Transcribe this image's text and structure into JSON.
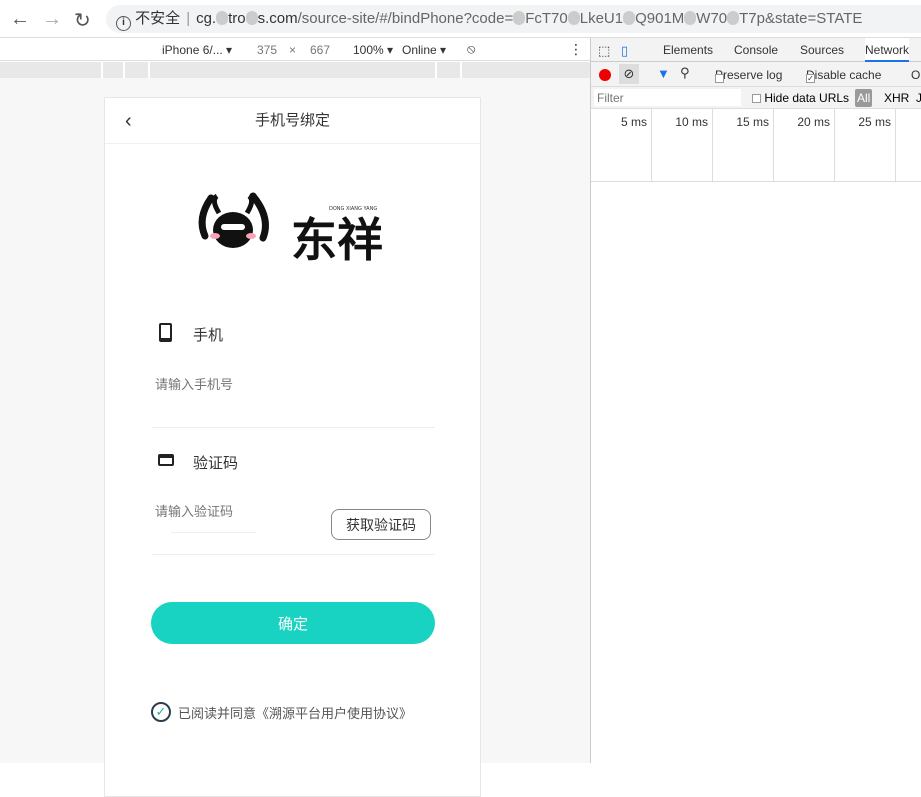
{
  "browser": {
    "insecure_label": "不安全",
    "url_host_a": "cg.",
    "url_host_b": "tro",
    "url_host_c": "s.com",
    "url_path": "/source-site/#/bindPhone?code=",
    "url_q1": "FcT70",
    "url_q2": "LkeU1",
    "url_q3": "Q901M",
    "url_q4": "W70",
    "url_q5": "T7p&state=STATE"
  },
  "device_toolbar": {
    "device": "iPhone 6/...",
    "width": "375",
    "x": "×",
    "height": "667",
    "zoom": "100%",
    "network": "Online"
  },
  "page": {
    "title": "手机号绑定",
    "logo_text": "东祥",
    "logo_sub": "DONG XIANG YANG",
    "phone_label": "手机",
    "phone_placeholder": "请输入手机号",
    "code_label": "验证码",
    "code_placeholder": "请输入验证码",
    "get_code": "获取验证码",
    "confirm": "确定",
    "agree_text": "已阅读并同意《溯源平台用户使用协议》",
    "accent": "#18d3c2"
  },
  "devtools": {
    "tabs": [
      "Elements",
      "Console",
      "Sources",
      "Network"
    ],
    "active_tab": "Network",
    "preserve_log": "Preserve log",
    "disable_cache": "Disable cache",
    "online": "On",
    "filter_placeholder": "Filter",
    "hide_data_urls": "Hide data URLs",
    "types": [
      "All",
      "XHR",
      "JS"
    ],
    "ticks": [
      "5 ms",
      "10 ms",
      "15 ms",
      "20 ms",
      "25 ms"
    ]
  }
}
